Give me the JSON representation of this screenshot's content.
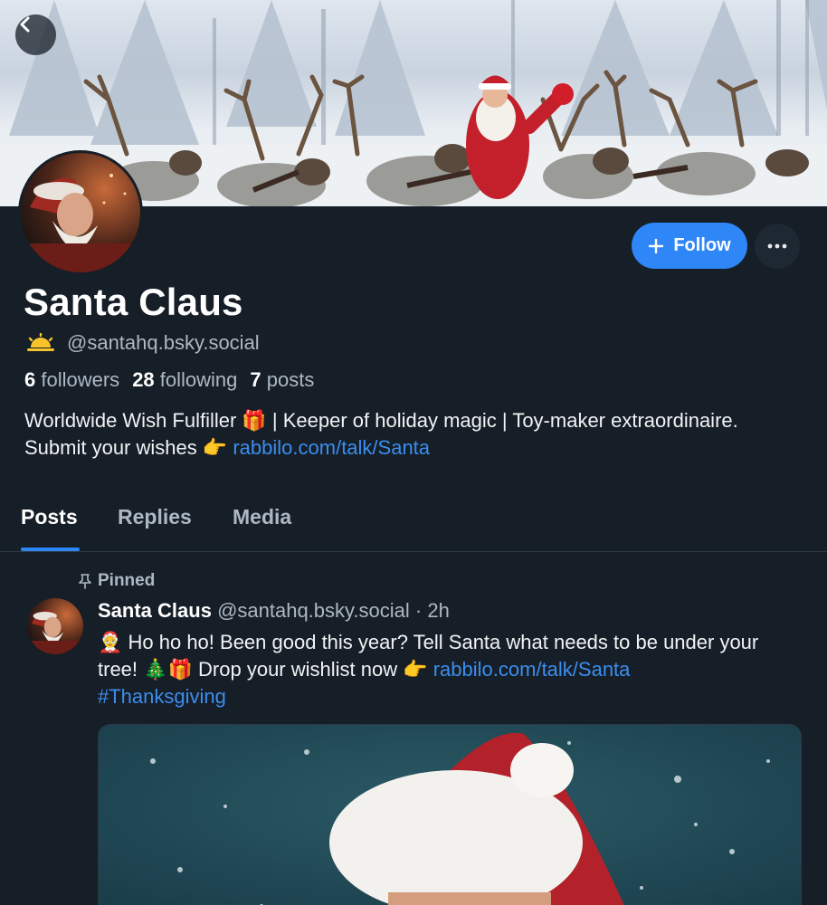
{
  "profile": {
    "display_name": "Santa Claus",
    "handle": "@santahq.bsky.social",
    "followers_count": "6",
    "followers_label": "followers",
    "following_count": "28",
    "following_label": "following",
    "posts_count": "7",
    "posts_label": "posts",
    "bio_text": "Worldwide Wish Fulfiller 🎁 | Keeper of holiday magic | Toy-maker extraordinaire. Submit your wishes 👉 ",
    "bio_link": "rabbilo.com/talk/Santa"
  },
  "actions": {
    "follow_label": "Follow",
    "more_icon": "ellipsis-icon",
    "back_icon": "chevron-left-icon"
  },
  "tabs": [
    {
      "label": "Posts",
      "active": true
    },
    {
      "label": "Replies",
      "active": false
    },
    {
      "label": "Media",
      "active": false
    }
  ],
  "post": {
    "pinned_label": "Pinned",
    "author_name": "Santa Claus",
    "author_handle": "@santahq.bsky.social",
    "time": "· 2h",
    "text": "🤶 Ho ho ho! Been good this year? Tell Santa what needs to be under your tree! 🎄🎁 Drop your wishlist now 👉 ",
    "link": "rabbilo.com/talk/Santa",
    "hashtag": "#Thanksgiving"
  },
  "colors": {
    "background": "#161e27",
    "accent": "#2f86f6",
    "link": "#3b8eef",
    "muted_text": "#aeb8c4"
  }
}
